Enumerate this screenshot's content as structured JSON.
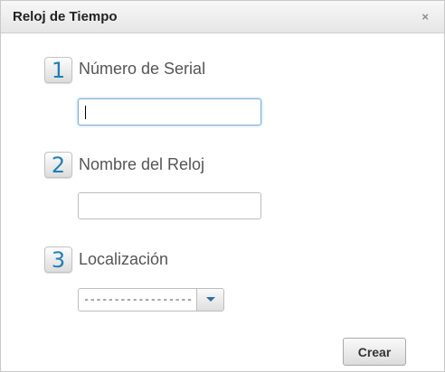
{
  "dialog": {
    "title": "Reloj de Tiempo",
    "close_label": "×"
  },
  "fields": [
    {
      "step": "1",
      "label": "Número de Serial",
      "value": "",
      "placeholder": ""
    },
    {
      "step": "2",
      "label": "Nombre del Reloj",
      "value": "",
      "placeholder": ""
    },
    {
      "step": "3",
      "label": "Localización",
      "selected": "------------------------"
    }
  ],
  "actions": {
    "create_label": "Crear"
  },
  "colors": {
    "step_number": "#1e7fb8",
    "dropdown_arrow": "#2c6fa3"
  },
  "icons": {
    "close": "close-icon",
    "dropdown": "chevron-down-icon"
  }
}
